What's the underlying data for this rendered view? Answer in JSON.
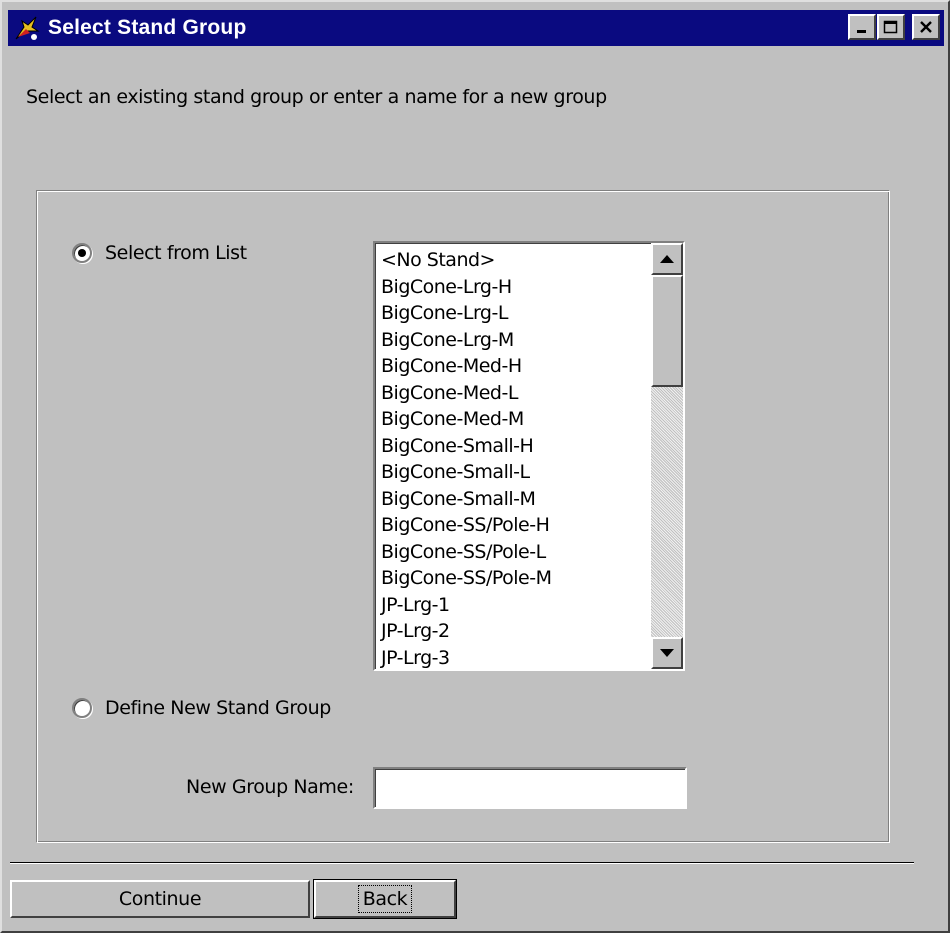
{
  "window": {
    "title": "Select Stand Group",
    "icon": "app-icon",
    "controls": [
      "minimize",
      "maximize",
      "close"
    ]
  },
  "instruction": "Select an existing stand group or enter a name for a new group",
  "options": {
    "select_from_list": {
      "label": "Select from List",
      "selected": true
    },
    "define_new": {
      "label": "Define New Stand Group",
      "selected": false
    }
  },
  "stand_list": {
    "items": [
      "<No Stand>",
      "BigCone-Lrg-H",
      "BigCone-Lrg-L",
      "BigCone-Lrg-M",
      "BigCone-Med-H",
      "BigCone-Med-L",
      "BigCone-Med-M",
      "BigCone-Small-H",
      "BigCone-Small-L",
      "BigCone-Small-M",
      "BigCone-SS/Pole-H",
      "BigCone-SS/Pole-L",
      "BigCone-SS/Pole-M",
      "JP-Lrg-1",
      "JP-Lrg-2",
      "JP-Lrg-3"
    ]
  },
  "new_group": {
    "label": "New Group Name:",
    "value": ""
  },
  "buttons": {
    "continue": "Continue",
    "back": "Back"
  },
  "colors": {
    "titlebar": "#0a0a80",
    "face": "#c0c0c0"
  }
}
